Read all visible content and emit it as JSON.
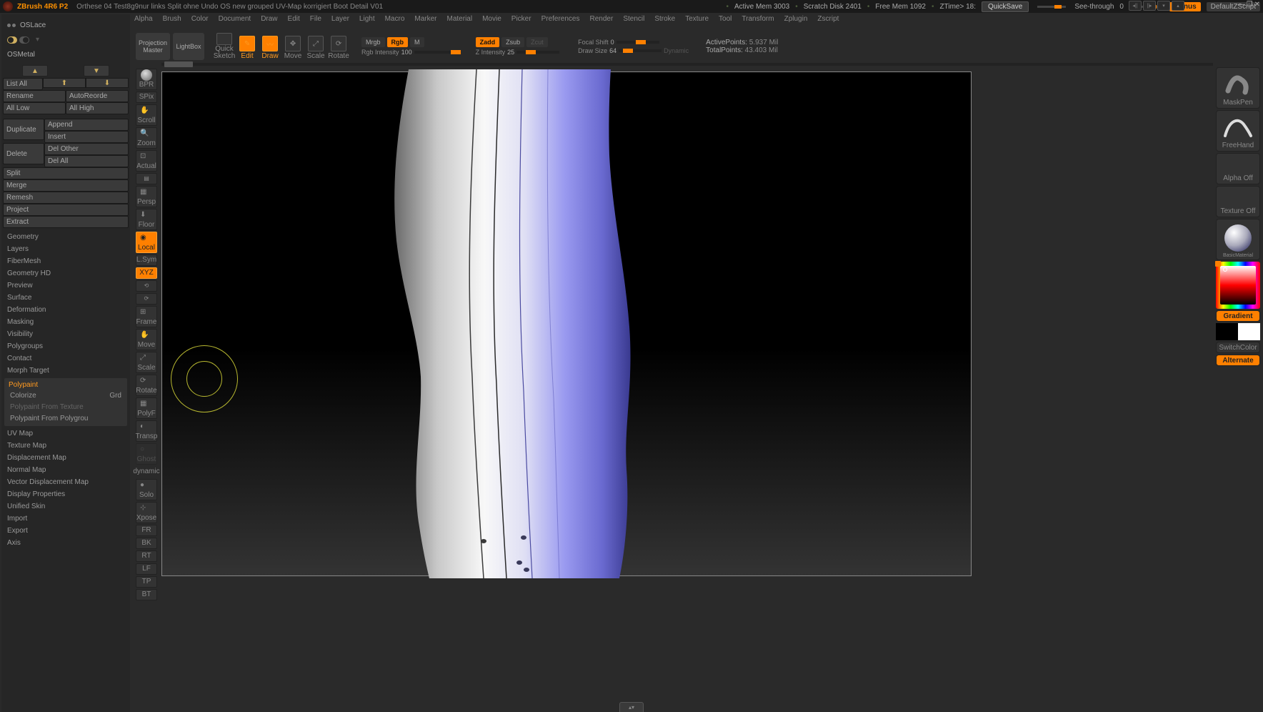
{
  "title": {
    "app": "ZBrush 4R6 P2",
    "doc": "Orthese 04 Test8g9nur links Split ohne Undo OS new grouped UV-Map korrigiert Boot Detail V01",
    "stats": {
      "active_mem": "Active Mem 3003",
      "scratch": "Scratch Disk 2401",
      "free_mem": "Free Mem 1092",
      "ztime": "ZTime> 18:"
    },
    "quicksave": "QuickSave",
    "seethrough": "See-through",
    "seethrough_val": "0",
    "menus": "Menus",
    "zscript": "DefaultZScript"
  },
  "menus": [
    "Alpha",
    "Brush",
    "Color",
    "Document",
    "Draw",
    "Edit",
    "File",
    "Layer",
    "Light",
    "Macro",
    "Marker",
    "Material",
    "Movie",
    "Picker",
    "Preferences",
    "Render",
    "Stencil",
    "Stroke",
    "Texture",
    "Tool",
    "Transform",
    "Zplugin",
    "Zscript"
  ],
  "toolbar": {
    "projection": "Projection\nMaster",
    "lightbox": "LightBox",
    "quicksketch": "Quick\nSketch",
    "edit": "Edit",
    "draw": "Draw",
    "move": "Move",
    "scale": "Scale",
    "rotate": "Rotate",
    "mrgb": "Mrgb",
    "rgb": "Rgb",
    "m": "M",
    "rgb_intensity": "Rgb Intensity",
    "rgb_intensity_val": "100",
    "zadd": "Zadd",
    "zsub": "Zsub",
    "zcut": "Zcut",
    "z_intensity": "Z Intensity",
    "z_intensity_val": "25",
    "focal": "Focal Shift",
    "focal_val": "0",
    "drawsize": "Draw Size",
    "drawsize_val": "64",
    "dynamic": "Dynamic",
    "active_pts_lbl": "ActivePoints:",
    "active_pts": "5.937 Mil",
    "total_pts_lbl": "TotalPoints:",
    "total_pts": "43.403 Mil"
  },
  "left": {
    "swatch1": "OSLace",
    "swatch2": "OSMetal",
    "listall": "List All",
    "rename": "Rename",
    "autoreorder": "AutoReorde",
    "alllow": "All Low",
    "allhigh": "All High",
    "duplicate": "Duplicate",
    "append": "Append",
    "insert": "Insert",
    "delete": "Delete",
    "delother": "Del Other",
    "delall": "Del All",
    "split": "Split",
    "merge": "Merge",
    "remesh": "Remesh",
    "project": "Project",
    "extract": "Extract",
    "tree": [
      "Geometry",
      "Layers",
      "FiberMesh",
      "Geometry HD",
      "Preview",
      "Surface",
      "Deformation",
      "Masking",
      "Visibility",
      "Polygroups",
      "Contact",
      "Morph Target"
    ],
    "poly_hdr": "Polypaint",
    "poly_items": {
      "colorize": "Colorize",
      "grd": "Grd",
      "pfr_tex": "Polypaint From Texture",
      "pfr_pg": "Polypaint From Polygrou"
    },
    "tree2": [
      "UV Map",
      "Texture Map",
      "Displacement Map",
      "Normal Map",
      "Vector Displacement Map",
      "Display Properties",
      "Unified Skin",
      "Import",
      "Export",
      "Axis"
    ]
  },
  "strip": {
    "bpr": "BPR",
    "spix": "SPix",
    "scroll": "Scroll",
    "zoom": "Zoom",
    "actual": "Actual",
    "aahalf": "",
    "persp": "Persp",
    "floor": "Floor",
    "local": "Local",
    "lsym": "L.Sym",
    "xyz": "XYZ",
    "frame": "Frame",
    "move": "Move",
    "scale": "Scale",
    "rotate": "Rotate",
    "polyf": "PolyF",
    "transp": "Transp",
    "ghost": "Ghost",
    "solo": "Solo",
    "dynamic": "dynamic",
    "xpose": "Xpose",
    "fr": "FR",
    "bk": "BK",
    "rt": "RT",
    "lf": "LF",
    "tp": "TP",
    "bt": "BT"
  },
  "right": {
    "maskpen": "MaskPen",
    "freehand": "FreeHand",
    "alphaoff": "Alpha Off",
    "texoff": "Texture Off",
    "material": "BasicMaterial",
    "gradient": "Gradient",
    "switch": "SwitchColor",
    "alternate": "Alternate"
  }
}
